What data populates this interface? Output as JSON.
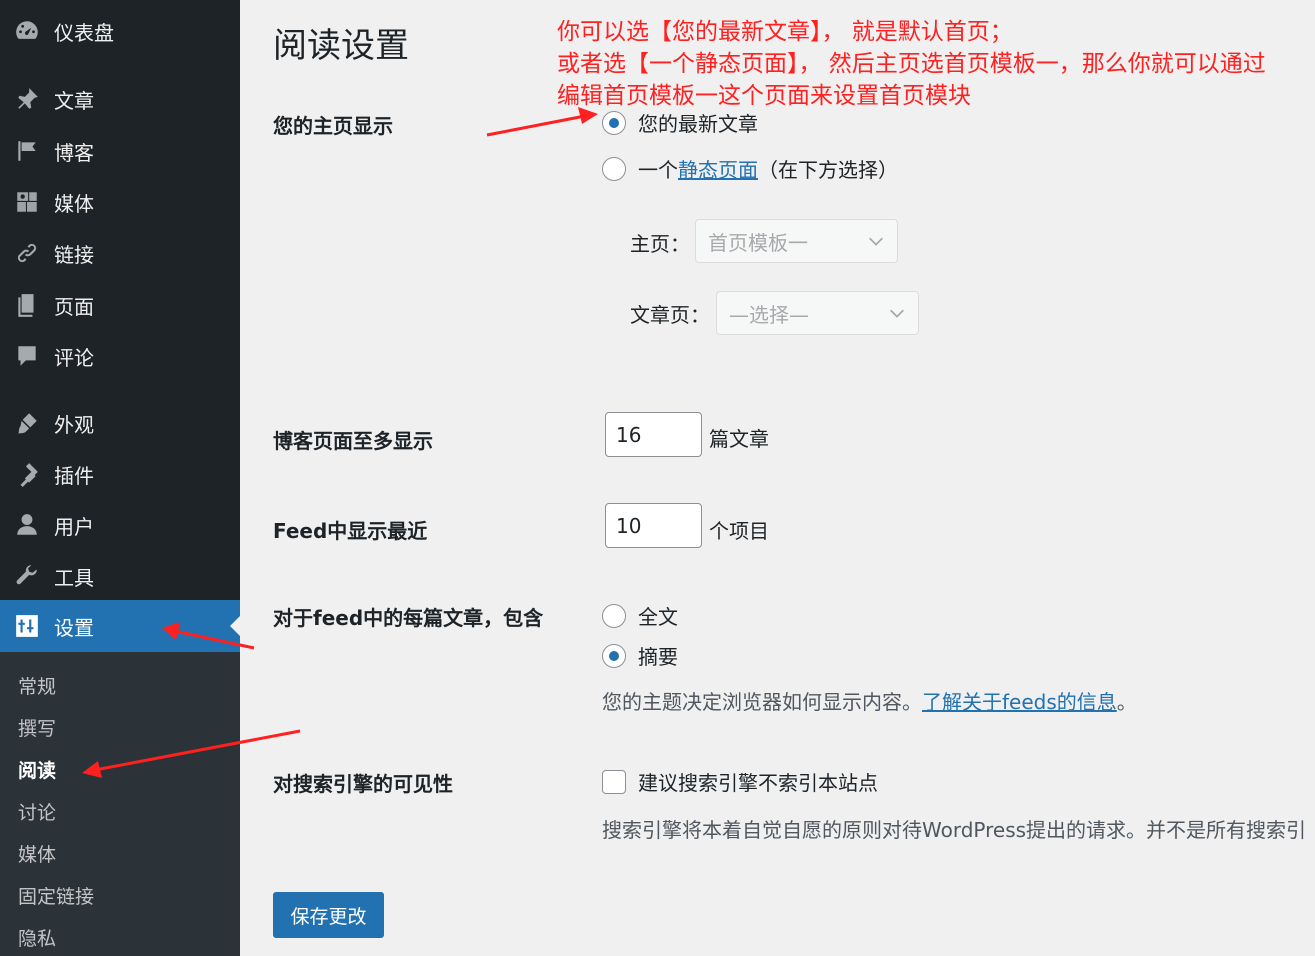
{
  "sidebar": {
    "items": [
      {
        "label": "仪表盘",
        "icon": "dashboard-icon"
      },
      {
        "label": "文章",
        "icon": "pin-icon"
      },
      {
        "label": "博客",
        "icon": "flag-icon"
      },
      {
        "label": "媒体",
        "icon": "media-icon"
      },
      {
        "label": "链接",
        "icon": "link-icon"
      },
      {
        "label": "页面",
        "icon": "pages-icon"
      },
      {
        "label": "评论",
        "icon": "comment-icon"
      },
      {
        "label": "外观",
        "icon": "brush-icon"
      },
      {
        "label": "插件",
        "icon": "plugin-icon"
      },
      {
        "label": "用户",
        "icon": "user-icon"
      },
      {
        "label": "工具",
        "icon": "wrench-icon"
      },
      {
        "label": "设置",
        "icon": "settings-icon"
      }
    ],
    "submenu": [
      "常规",
      "撰写",
      "阅读",
      "讨论",
      "媒体",
      "固定链接",
      "隐私"
    ],
    "current_submenu": "阅读"
  },
  "page": {
    "title": "阅读设置",
    "homepage": {
      "label": "您的主页显示",
      "option_latest": "您的最新文章",
      "option_static_prefix": "一个",
      "option_static_link": "静态页面",
      "option_static_suffix": "（在下方选择）",
      "selected": "latest",
      "front_label": "主页：",
      "front_value": "首页模板一",
      "posts_label": "文章页：",
      "posts_value": "—选择—"
    },
    "posts_per_page": {
      "label": "博客页面至多显示",
      "value": "16",
      "unit": "篇文章"
    },
    "feed_recent": {
      "label": "Feed中显示最近",
      "value": "10",
      "unit": "个项目"
    },
    "feed_content": {
      "label": "对于feed中的每篇文章，包含",
      "option_full": "全文",
      "option_summary": "摘要",
      "selected": "summary",
      "desc_prefix": "您的主题决定浏览器如何显示内容。",
      "desc_link": "了解关于feeds的信息",
      "desc_suffix": "。"
    },
    "search_visibility": {
      "label": "对搜索引擎的可见性",
      "checkbox_label": "建议搜索引擎不索引本站点",
      "checked": false,
      "desc": "搜索引擎将本着自觉自愿的原则对待WordPress提出的请求。并不是所有搜索引"
    },
    "save_button": "保存更改"
  },
  "annotation": {
    "line1": "你可以选【您的最新文章】， 就是默认首页；",
    "line2": "或者选【一个静态页面】， 然后主页选首页模板一，那么你就可以通过",
    "line3": "编辑首页模板一这个页面来设置首页模块"
  },
  "colors": {
    "sidebar_bg": "#1d2327",
    "submenu_bg": "#2c3338",
    "accent": "#2271b1",
    "annotation": "#ff2020",
    "page_bg": "#f0f0f1"
  }
}
